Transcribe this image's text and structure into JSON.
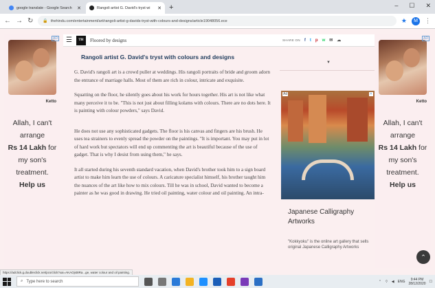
{
  "browser": {
    "tabs": [
      {
        "title": "google translate - Google Search",
        "favicon_color": "#4285f4",
        "active": false
      },
      {
        "title": "Rangoli artist G. David's tryst wi",
        "favicon_color": "#222222",
        "active": true
      }
    ],
    "new_tab_label": "+",
    "url": "thehindu.com/entertainment/art/rangoli-artist-g-davids-tryst-with-colours-and-designs/article19048056.ece",
    "window_controls": [
      "–",
      "☐",
      "✕"
    ],
    "profile_initial": "M"
  },
  "header": {
    "logo_text": "TH",
    "label": "Floored by designs"
  },
  "share": {
    "label": "SHARE ON",
    "icons": [
      "f",
      "t",
      "p",
      "w",
      "✉",
      "☁"
    ]
  },
  "article": {
    "title": "Rangoli artist G. David's tryst with colours and designs",
    "paragraphs": [
      "G. David's rangoli art is a crowd puller at weddings. His rangoli portraits of bride and groom adorn the entrance of marriage halls. Most of them are rich in colour, intricate and exquisite.",
      "Squatting on the floor, he silently goes about his work for hours together. His art is not like what many perceive it to be. \"This is not just about filling kolams with colours. There are no dots here. It is painting with colour powders,\" says David.",
      "He does not use any sophisticated gadgets. The floor is his canvas and fingers are his brush. He uses tea strainers to evenly spread the powder on the paintings. \"It is important. You may put in lot of hard work but spectators will end up commenting the art is beautiful because of the use of gadget. That is why I desist from using them,\" he says.",
      "It all started during his seventh standard vacation, when David's brother took him to a sign board artist to make him learn the use of colours. A caricature specialist himself, his brother taught him the nuances of the art like how to mix colours. Till he was in school, David wanted to become a painter as he was good in drawing. He tried oil painting, water colour and oil painting. An intra-"
    ]
  },
  "side_ad": {
    "brand": "Ketto",
    "line1": "Allah, I can't",
    "line2": "arrange",
    "amount": "Rs 14 Lakh",
    "line3": "for",
    "line4": "my son's",
    "line5": "treatment.",
    "cta": "Help us",
    "ad_badge": "AD"
  },
  "right_ad": {
    "ad_label": "Ad",
    "title": "Japanese Calligraphy Artworks",
    "description": "\"Kokkyoku\" is the online art gallery that sells original Japanese Calligraphy Artworks"
  },
  "status_url": "https://adclick.g.doubleclick.net/pcs/click?xai=AKAOjst8Ra...ge, water colour and oil painting.",
  "taskbar": {
    "search_placeholder": "Type here to search",
    "tray_lang": "ENG",
    "time": "9:44 PM",
    "date": "28/12/2020"
  }
}
